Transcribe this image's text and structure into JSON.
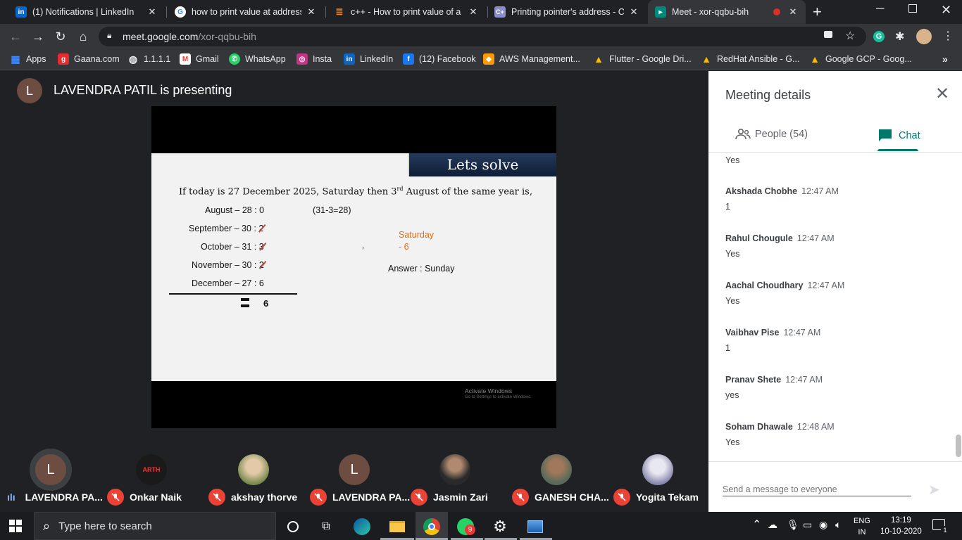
{
  "tabs": [
    {
      "title": "(1) Notifications | LinkedIn",
      "icon": "linkedin-icon"
    },
    {
      "title": "how to print value at address i",
      "icon": "google-icon"
    },
    {
      "title": "c++ - How to print value of a V",
      "icon": "stackoverflow-icon"
    },
    {
      "title": "Printing pointer's address - C+",
      "icon": "cplusplus-icon"
    },
    {
      "title": "Meet - xor-qqbu-bih",
      "icon": "meet-icon"
    }
  ],
  "url": {
    "domain": "meet.google.com",
    "path": "/xor-qqbu-bih"
  },
  "bookmarks": [
    "Apps",
    "Gaana.com",
    "1.1.1.1",
    "Gmail",
    "WhatsApp",
    "Insta",
    "LinkedIn",
    "(12) Facebook",
    "AWS Management...",
    "Flutter - Google Dri...",
    "RedHat Ansible - G...",
    "Google GCP - Goog..."
  ],
  "presenter": {
    "initial": "L",
    "text": "LAVENDRA PATIL is presenting"
  },
  "slide": {
    "banner": "Lets solve",
    "question_pre": "If today is 27 December 2025, Saturday then 3",
    "question_sup": "rd",
    "question_post": " August of the same year is,",
    "rows": [
      {
        "label": "August –  28 : ",
        "val": "0"
      },
      {
        "label": "September –  30 : ",
        "val": "2"
      },
      {
        "label": "October –  31 : ",
        "val": "3"
      },
      {
        "label": "November – 30 : ",
        "val": "2"
      },
      {
        "label": "December – 27 : ",
        "val": "6"
      }
    ],
    "note": "(31-3=28)",
    "result_label": "Saturday",
    "result_value": "- 6",
    "answer": "Answer : Sunday",
    "total": "6",
    "watermark_1": "Activate Windows",
    "watermark_2": "Go to Settings to activate Windows."
  },
  "participants": [
    {
      "name": "LAVENDRA PA...",
      "initial": "L",
      "muted": false
    },
    {
      "name": "Onkar Naik",
      "initial": "ARTH",
      "muted": true
    },
    {
      "name": "akshay thorve",
      "initial": "",
      "muted": true
    },
    {
      "name": "LAVENDRA PA...",
      "initial": "L",
      "muted": true
    },
    {
      "name": "Jasmin Zari",
      "initial": "",
      "muted": true
    },
    {
      "name": "GANESH CHA...",
      "initial": "",
      "muted": true
    },
    {
      "name": "Yogita Tekam",
      "initial": "",
      "muted": true
    }
  ],
  "panel": {
    "title": "Meeting details",
    "people_tab": "People (54)",
    "chat_tab": "Chat",
    "top_partial": "Yes",
    "messages": [
      {
        "sender": "Akshada Chobhe",
        "time": "12:47 AM",
        "text": "1"
      },
      {
        "sender": "Rahul Chougule",
        "time": "12:47 AM",
        "text": "Yes"
      },
      {
        "sender": "Aachal Choudhary",
        "time": "12:47 AM",
        "text": "Yes"
      },
      {
        "sender": "Vaibhav Pise",
        "time": "12:47 AM",
        "text": "1"
      },
      {
        "sender": "Pranav Shete",
        "time": "12:47 AM",
        "text": "yes"
      },
      {
        "sender": "Soham Dhawale",
        "time": "12:48 AM",
        "text": "Yes"
      }
    ],
    "compose_placeholder": "Send a message to everyone"
  },
  "taskbar": {
    "search_placeholder": "Type here to search",
    "whatsapp_badge": "9",
    "lang_top": "ENG",
    "lang_bottom": "IN",
    "time": "13:19",
    "date": "10-10-2020",
    "notification_count": "1"
  },
  "colors": {
    "accent": "#00796b",
    "mute_red": "#ea4335",
    "slide_orange": "#e46c0a",
    "banner_navy": "#1a2b4a"
  }
}
